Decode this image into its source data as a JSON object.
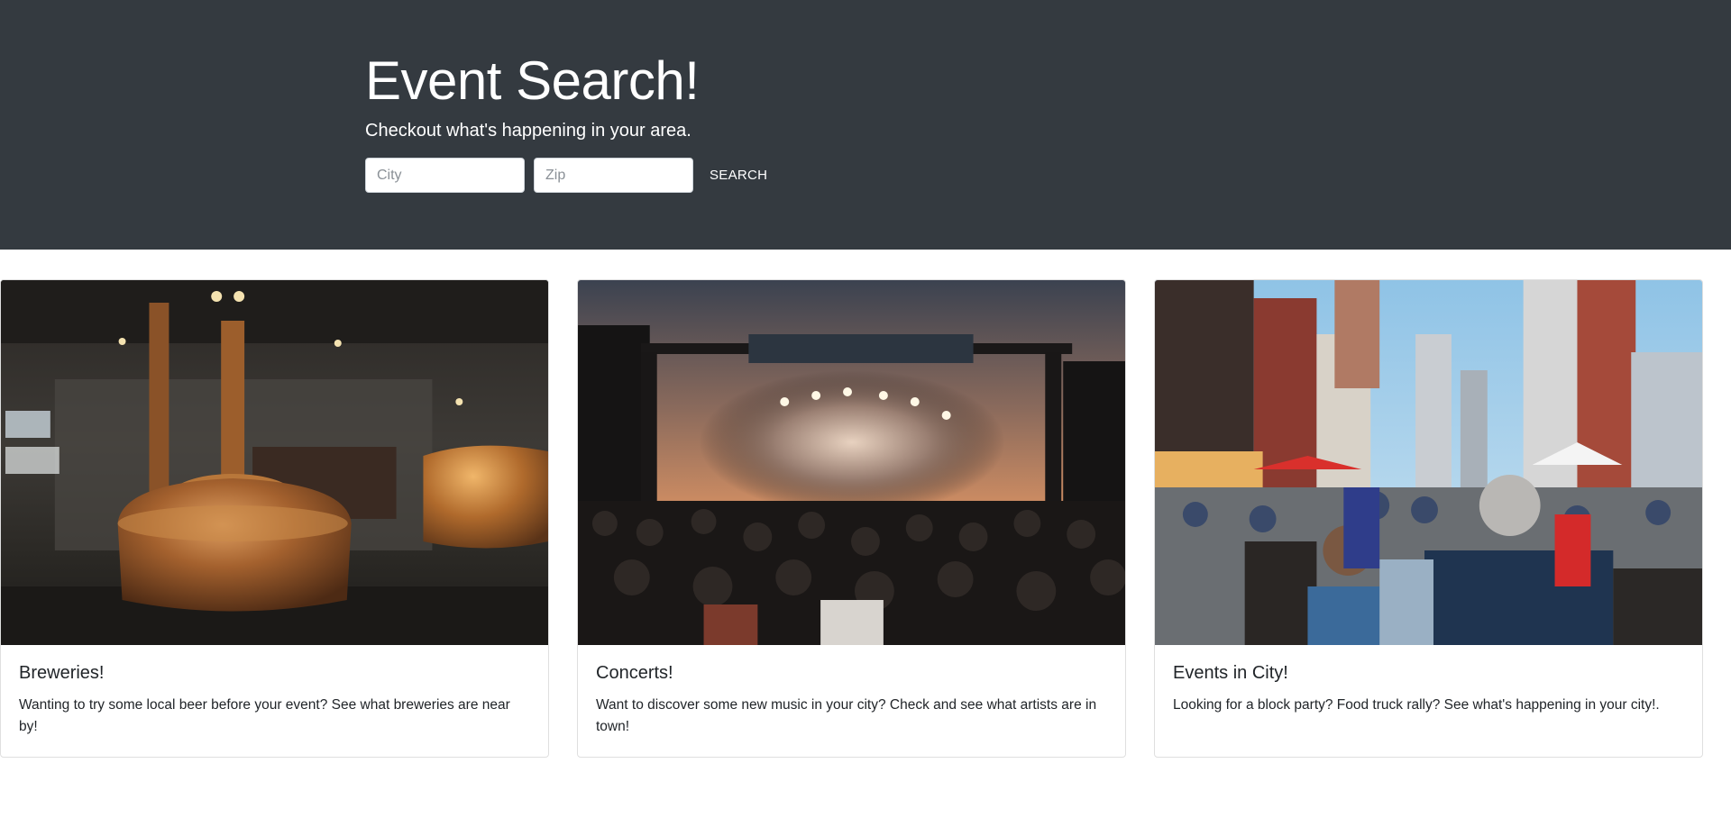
{
  "hero": {
    "title": "Event Search!",
    "subtitle": "Checkout what's happening in your area.",
    "city_placeholder": "City",
    "zip_placeholder": "Zip",
    "search_label": "SEARCH",
    "background_color": "#343a40"
  },
  "cards": [
    {
      "title": "Breweries!",
      "text": "Wanting to try some local beer before your event? See what breweries are near by!",
      "image": "brewery-photo"
    },
    {
      "title": "Concerts!",
      "text": "Want to discover some new music in your city? Check and see what artists are in town!",
      "image": "concert-photo"
    },
    {
      "title": "Events in City!",
      "text": "Looking for a block party? Food truck rally? See what's happening in your city!.",
      "image": "street-fair-photo"
    }
  ]
}
